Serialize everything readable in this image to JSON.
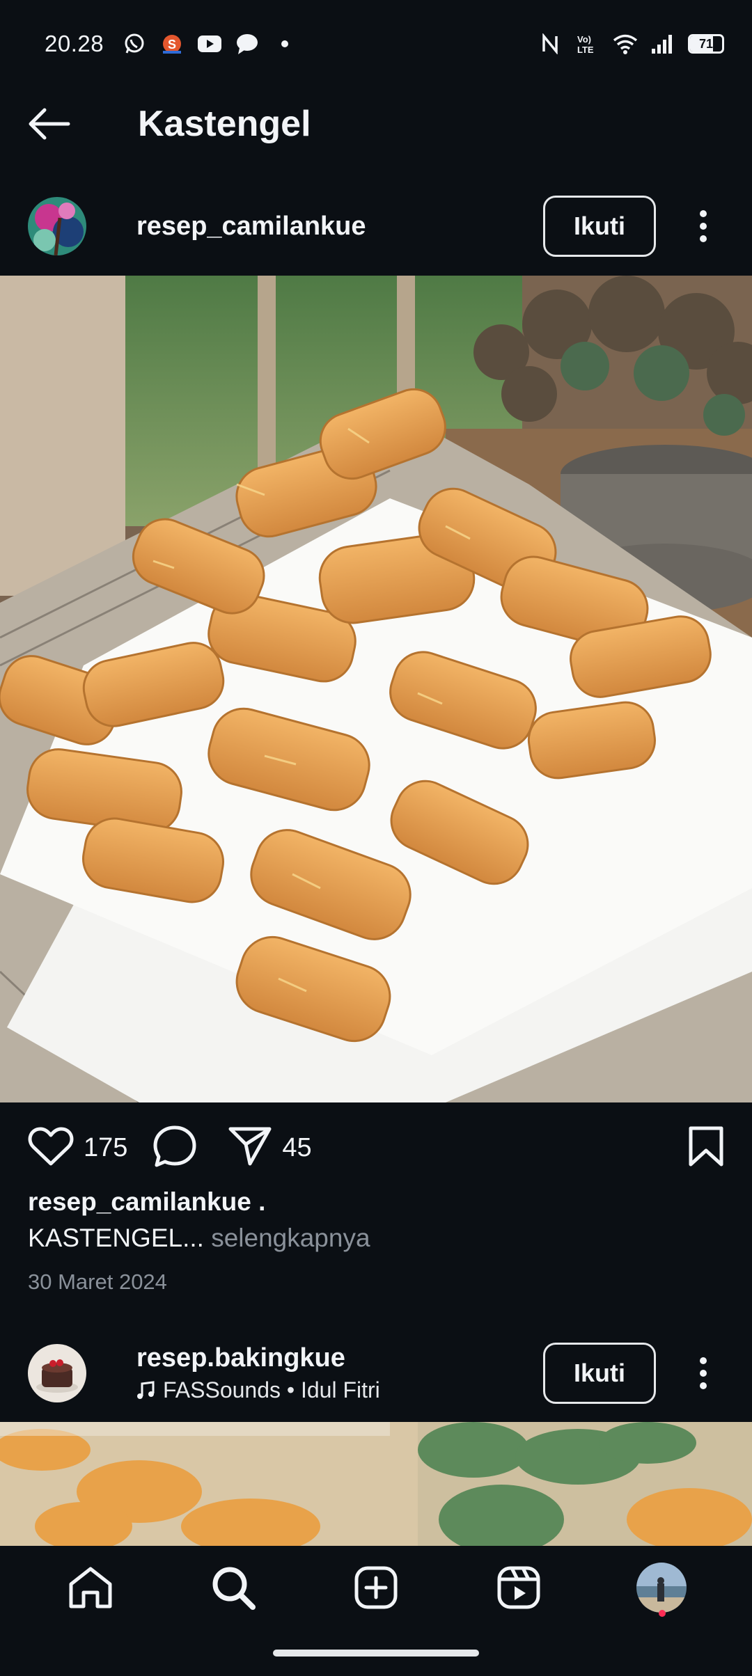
{
  "status_bar": {
    "time": "20.28",
    "battery": "71",
    "battery_level": 0.71,
    "left_icons": [
      "whatsapp-icon",
      "shopee-icon",
      "youtube-icon",
      "chat-bubble-icon",
      "dot-icon"
    ],
    "right_icons": [
      "nfc-icon",
      "volte-icon",
      "wifi-icon",
      "signal-icon",
      "battery-icon"
    ]
  },
  "header": {
    "title": "Kastengel"
  },
  "post": {
    "username": "resep_camilankue",
    "follow_label": "Ikuti",
    "likes": "175",
    "shares": "45",
    "caption_user": "resep_camilankue .",
    "caption_text": "KASTENGEL...",
    "more_label": " selengkapnya",
    "date": "30 Maret 2024"
  },
  "next_post": {
    "username": "resep.bakingkue",
    "audio": "FASSounds • Idul Fitri",
    "follow_label": "Ikuti"
  },
  "nav": {
    "items": [
      "home-icon",
      "search-icon",
      "create-icon",
      "reels-icon",
      "profile-avatar"
    ]
  },
  "colors": {
    "background": "#0b0f14",
    "text": "#f2f4f7",
    "muted": "#8a919a",
    "notification_dot": "#ff2d55"
  }
}
